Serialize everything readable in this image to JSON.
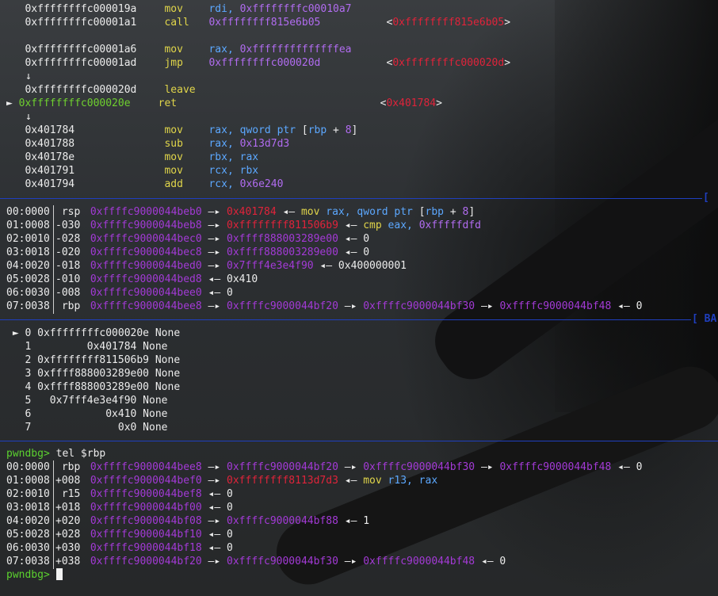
{
  "disasm": [
    {
      "marker": "",
      "addr": "0xffffffffc000019a",
      "addr_color": "white",
      "mnem": "mov",
      "ops": [
        {
          "t": "rdi, ",
          "c": "blue"
        },
        {
          "t": "0xffffffffc00010a7",
          "c": "purple"
        }
      ],
      "target": ""
    },
    {
      "marker": "",
      "addr": "0xffffffffc00001a1",
      "addr_color": "white",
      "mnem": "call",
      "ops": [
        {
          "t": "0xffffffff815e6b05",
          "c": "purple"
        }
      ],
      "target": "0xffffffff815e6b05"
    },
    {
      "marker": "",
      "addr": "",
      "addr_color": "white",
      "mnem": "",
      "ops": [],
      "target": ""
    },
    {
      "marker": "",
      "addr": "0xffffffffc00001a6",
      "addr_color": "white",
      "mnem": "mov",
      "ops": [
        {
          "t": "rax, ",
          "c": "blue"
        },
        {
          "t": "0xffffffffffffffea",
          "c": "purple"
        }
      ],
      "target": ""
    },
    {
      "marker": "",
      "addr": "0xffffffffc00001ad",
      "addr_color": "white",
      "mnem": "jmp",
      "ops": [
        {
          "t": "0xffffffffc000020d",
          "c": "purple"
        }
      ],
      "target": "0xffffffffc000020d"
    },
    {
      "marker": "  ↓",
      "addr": "",
      "addr_color": "white",
      "mnem": "",
      "ops": [],
      "target": ""
    },
    {
      "marker": "",
      "addr": "0xffffffffc000020d",
      "addr_color": "white",
      "mnem": "leave",
      "ops": [],
      "target": ""
    },
    {
      "marker": "►",
      "addr": "0xffffffffc000020e",
      "addr_color": "green",
      "mnem": "ret",
      "ops": [],
      "target": "0x401784"
    },
    {
      "marker": "  ↓",
      "addr": "",
      "addr_color": "white",
      "mnem": "",
      "ops": [],
      "target": ""
    },
    {
      "marker": "",
      "addr": "0x401784",
      "addr_color": "white",
      "mnem": "mov",
      "ops": [
        {
          "t": "rax, ",
          "c": "blue"
        },
        {
          "t": "qword ptr ",
          "c": "blue"
        },
        {
          "t": "[",
          "c": "white"
        },
        {
          "t": "rbp",
          "c": "blue"
        },
        {
          "t": " + ",
          "c": "white"
        },
        {
          "t": "8",
          "c": "purple"
        },
        {
          "t": "]",
          "c": "white"
        }
      ],
      "target": ""
    },
    {
      "marker": "",
      "addr": "0x401788",
      "addr_color": "white",
      "mnem": "sub",
      "ops": [
        {
          "t": "rax, ",
          "c": "blue"
        },
        {
          "t": "0x13d7d3",
          "c": "purple"
        }
      ],
      "target": ""
    },
    {
      "marker": "",
      "addr": "0x40178e",
      "addr_color": "white",
      "mnem": "mov",
      "ops": [
        {
          "t": "rbx, rax",
          "c": "blue"
        }
      ],
      "target": ""
    },
    {
      "marker": "",
      "addr": "0x401791",
      "addr_color": "white",
      "mnem": "mov",
      "ops": [
        {
          "t": "rcx, rbx",
          "c": "blue"
        }
      ],
      "target": ""
    },
    {
      "marker": "",
      "addr": "0x401794",
      "addr_color": "white",
      "mnem": "add",
      "ops": [
        {
          "t": "rcx, ",
          "c": "blue"
        },
        {
          "t": "0x6e240",
          "c": "purple"
        }
      ],
      "target": ""
    }
  ],
  "section_labels": {
    "stack": "[",
    "backtrace": "[ BA"
  },
  "stack": [
    {
      "idx": "00:0000",
      "reg": " rsp",
      "parts": [
        {
          "t": "0xffffc9000044beb0",
          "c": "magenta"
        },
        {
          "t": " —▸ ",
          "c": "white"
        },
        {
          "t": "0x401784",
          "c": "red"
        },
        {
          "t": " ◂— ",
          "c": "white"
        },
        {
          "t": "mov ",
          "c": "yellow"
        },
        {
          "t": "rax, qword ptr ",
          "c": "blue"
        },
        {
          "t": "[",
          "c": "white"
        },
        {
          "t": "rbp",
          "c": "blue"
        },
        {
          "t": " + ",
          "c": "white"
        },
        {
          "t": "8",
          "c": "purple"
        },
        {
          "t": "]",
          "c": "white"
        }
      ]
    },
    {
      "idx": "01:0008",
      "reg": "-030",
      "parts": [
        {
          "t": "0xffffc9000044beb8",
          "c": "magenta"
        },
        {
          "t": " —▸ ",
          "c": "white"
        },
        {
          "t": "0xffffffff811506b9",
          "c": "red"
        },
        {
          "t": " ◂— ",
          "c": "white"
        },
        {
          "t": "cmp ",
          "c": "yellow"
        },
        {
          "t": "eax, ",
          "c": "blue"
        },
        {
          "t": "0xfffffdfd",
          "c": "purple"
        }
      ]
    },
    {
      "idx": "02:0010",
      "reg": "-028",
      "parts": [
        {
          "t": "0xffffc9000044bec0",
          "c": "magenta"
        },
        {
          "t": " —▸ ",
          "c": "white"
        },
        {
          "t": "0xffff888003289e00",
          "c": "magenta"
        },
        {
          "t": " ◂— 0",
          "c": "white"
        }
      ]
    },
    {
      "idx": "03:0018",
      "reg": "-020",
      "parts": [
        {
          "t": "0xffffc9000044bec8",
          "c": "magenta"
        },
        {
          "t": " —▸ ",
          "c": "white"
        },
        {
          "t": "0xffff888003289e00",
          "c": "magenta"
        },
        {
          "t": " ◂— 0",
          "c": "white"
        }
      ]
    },
    {
      "idx": "04:0020",
      "reg": "-018",
      "parts": [
        {
          "t": "0xffffc9000044bed0",
          "c": "magenta"
        },
        {
          "t": " —▸ ",
          "c": "white"
        },
        {
          "t": "0x7fff4e3e4f90",
          "c": "magenta"
        },
        {
          "t": " ◂— 0x400000001",
          "c": "white"
        }
      ]
    },
    {
      "idx": "05:0028",
      "reg": "-010",
      "parts": [
        {
          "t": "0xffffc9000044bed8",
          "c": "magenta"
        },
        {
          "t": " ◂— 0x410",
          "c": "white"
        }
      ]
    },
    {
      "idx": "06:0030",
      "reg": "-008",
      "parts": [
        {
          "t": "0xffffc9000044bee0",
          "c": "magenta"
        },
        {
          "t": " ◂— 0",
          "c": "white"
        }
      ]
    },
    {
      "idx": "07:0038",
      "reg": " rbp",
      "parts": [
        {
          "t": "0xffffc9000044bee8",
          "c": "magenta"
        },
        {
          "t": " —▸ ",
          "c": "white"
        },
        {
          "t": "0xffffc9000044bf20",
          "c": "magenta"
        },
        {
          "t": " —▸ ",
          "c": "white"
        },
        {
          "t": "0xffffc9000044bf30",
          "c": "magenta"
        },
        {
          "t": " —▸ ",
          "c": "white"
        },
        {
          "t": "0xffffc9000044bf48",
          "c": "magenta"
        },
        {
          "t": " ◂— 0",
          "c": "white"
        }
      ]
    }
  ],
  "backtrace": [
    " ► 0 0xffffffffc000020e None",
    "   1         0x401784 None",
    "   2 0xffffffff811506b9 None",
    "   3 0xffff888003289e00 None",
    "   4 0xffff888003289e00 None",
    "   5   0x7fff4e3e4f90 None",
    "   6            0x410 None",
    "   7              0x0 None"
  ],
  "prompt": "pwndbg>",
  "command": " tel $rbp",
  "tel": [
    {
      "idx": "00:0000",
      "reg": " rbp",
      "parts": [
        {
          "t": "0xffffc9000044bee8",
          "c": "magenta"
        },
        {
          "t": " —▸ ",
          "c": "white"
        },
        {
          "t": "0xffffc9000044bf20",
          "c": "magenta"
        },
        {
          "t": " —▸ ",
          "c": "white"
        },
        {
          "t": "0xffffc9000044bf30",
          "c": "magenta"
        },
        {
          "t": " —▸ ",
          "c": "white"
        },
        {
          "t": "0xffffc9000044bf48",
          "c": "magenta"
        },
        {
          "t": " ◂— 0",
          "c": "white"
        }
      ]
    },
    {
      "idx": "01:0008",
      "reg": "+008",
      "parts": [
        {
          "t": "0xffffc9000044bef0",
          "c": "magenta"
        },
        {
          "t": " —▸ ",
          "c": "white"
        },
        {
          "t": "0xffffffff8113d7d3",
          "c": "red"
        },
        {
          "t": " ◂— ",
          "c": "white"
        },
        {
          "t": "mov ",
          "c": "yellow"
        },
        {
          "t": "r13, rax",
          "c": "blue"
        }
      ]
    },
    {
      "idx": "02:0010",
      "reg": " r15",
      "parts": [
        {
          "t": "0xffffc9000044bef8",
          "c": "magenta"
        },
        {
          "t": " ◂— 0",
          "c": "white"
        }
      ]
    },
    {
      "idx": "03:0018",
      "reg": "+018",
      "parts": [
        {
          "t": "0xffffc9000044bf00",
          "c": "magenta"
        },
        {
          "t": " ◂— 0",
          "c": "white"
        }
      ]
    },
    {
      "idx": "04:0020",
      "reg": "+020",
      "parts": [
        {
          "t": "0xffffc9000044bf08",
          "c": "magenta"
        },
        {
          "t": " —▸ ",
          "c": "white"
        },
        {
          "t": "0xffffc9000044bf88",
          "c": "magenta"
        },
        {
          "t": " ◂— 1",
          "c": "white"
        }
      ]
    },
    {
      "idx": "05:0028",
      "reg": "+028",
      "parts": [
        {
          "t": "0xffffc9000044bf10",
          "c": "magenta"
        },
        {
          "t": " ◂— 0",
          "c": "white"
        }
      ]
    },
    {
      "idx": "06:0030",
      "reg": "+030",
      "parts": [
        {
          "t": "0xffffc9000044bf18",
          "c": "magenta"
        },
        {
          "t": " ◂— 0",
          "c": "white"
        }
      ]
    },
    {
      "idx": "07:0038",
      "reg": "+038",
      "parts": [
        {
          "t": "0xffffc9000044bf20",
          "c": "magenta"
        },
        {
          "t": " —▸ ",
          "c": "white"
        },
        {
          "t": "0xffffc9000044bf30",
          "c": "magenta"
        },
        {
          "t": " —▸ ",
          "c": "white"
        },
        {
          "t": "0xffffc9000044bf48",
          "c": "magenta"
        },
        {
          "t": " ◂— 0",
          "c": "white"
        }
      ]
    }
  ],
  "final_prompt": "pwndbg>"
}
